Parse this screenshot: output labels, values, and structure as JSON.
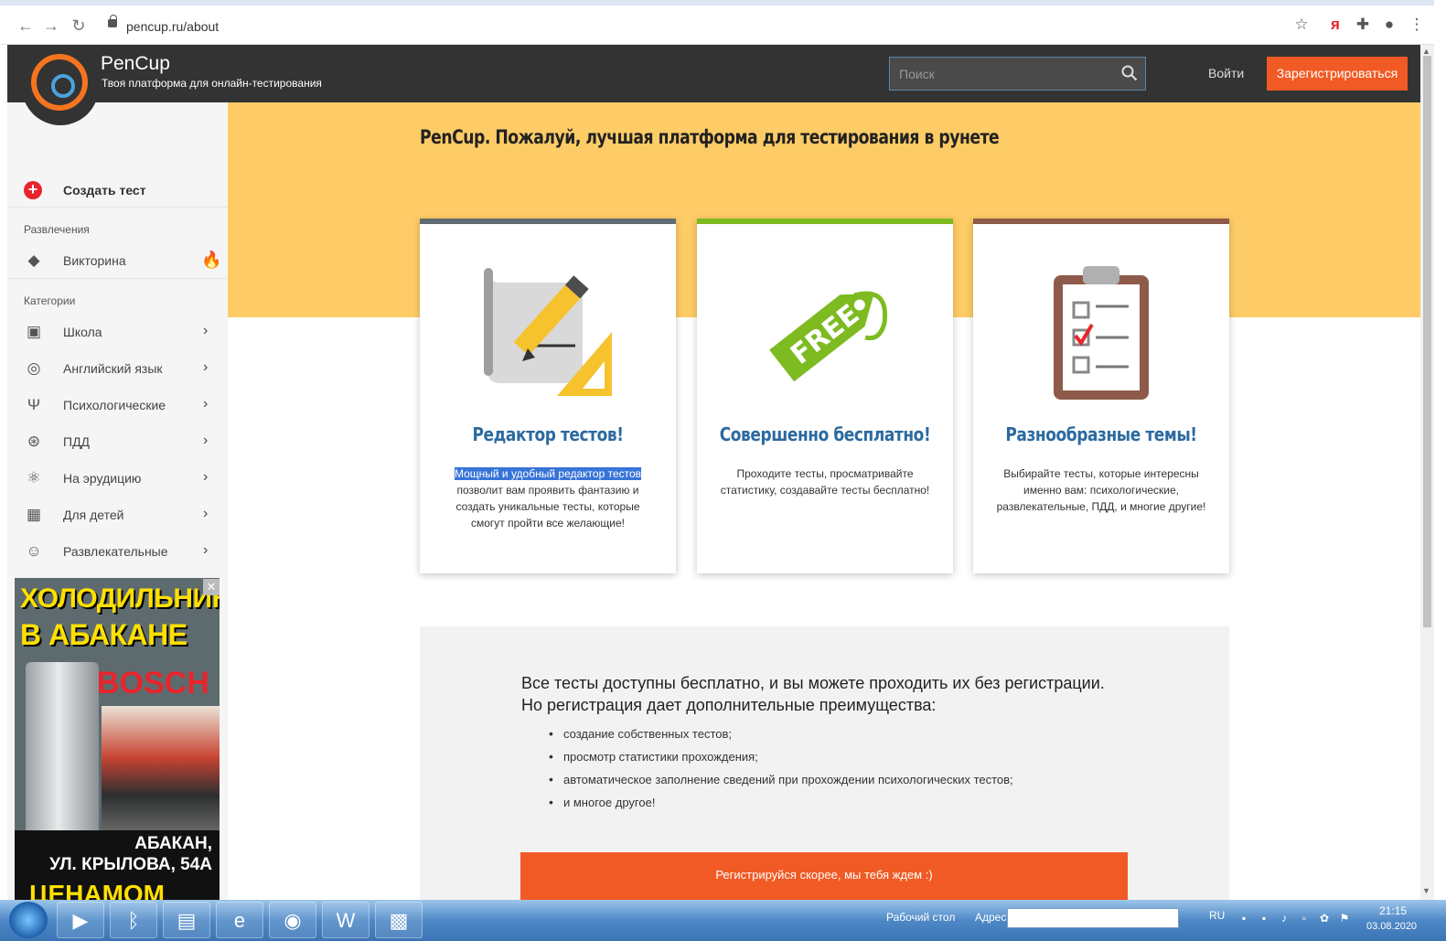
{
  "browser": {
    "url": "pencup.ru/about",
    "icons": [
      "back-icon",
      "forward-icon",
      "reload-icon",
      "lock-icon",
      "star-icon",
      "yandex-icon",
      "extensions-icon",
      "profile-icon",
      "menu-icon"
    ],
    "yandex_glyph": "я"
  },
  "header": {
    "brand": "PenCup",
    "tagline": "Твоя платформа для онлайн-тестирования",
    "search_placeholder": "Поиск",
    "login": "Войти",
    "register": "Зарегистрироваться"
  },
  "sidebar": {
    "create": "Создать тест",
    "section_fun": "Развлечения",
    "quiz": "Викторина",
    "section_categories": "Категории",
    "categories": [
      {
        "label": "Школа",
        "icon": "school-icon"
      },
      {
        "label": "Английский язык",
        "icon": "english-icon"
      },
      {
        "label": "Психологические",
        "icon": "psi-icon"
      },
      {
        "label": "ПДД",
        "icon": "steering-wheel-icon"
      },
      {
        "label": "На эрудицию",
        "icon": "atom-icon"
      },
      {
        "label": "Для детей",
        "icon": "blocks-icon"
      },
      {
        "label": "Развлекательные",
        "icon": "smiley-icon"
      }
    ]
  },
  "ad": {
    "line1": "ХОЛОДИЛЬНИКИ",
    "line2": "В АБАКАНЕ",
    "brand": "BOSCH",
    "city": "АБАКАН,",
    "street": "УЛ. КРЫЛОВА, 54А",
    "bottom": "ЦЕНАМОМ"
  },
  "main": {
    "title": "PenCup. Пожалуй, лучшая платформа для тестирования в рунете",
    "cards": [
      {
        "title": "Редактор тестов!",
        "highlight": "Мощный и удобный редактор тестов",
        "text": " позволит вам проявить фантазию и создать уникальные тесты, которые смогут пройти все желающие!",
        "accent": "#5f6b70"
      },
      {
        "title": "Совершенно бесплатно!",
        "highlight": "",
        "text": "Проходите тесты, просматривайте статистику, создавайте тесты бесплатно!",
        "accent": "#7dbb21"
      },
      {
        "title": "Разнообразные темы!",
        "highlight": "",
        "text": "Выбирайте тесты, которые интересны именно вам: психологические, развлекательные, ПДД, и многие другие!",
        "accent": "#8e5a4a"
      }
    ],
    "free_tag": "FREE",
    "info_line1": "Все тесты доступны бесплатно, и вы можете проходить их без регистрации.",
    "info_line2": "Но регистрация дает дополнительные преимущества:",
    "benefits": [
      "создание собственных тестов;",
      "просмотр статистики прохождения;",
      "автоматическое заполнение сведений при прохождении психологических тестов;",
      "и многое другое!"
    ],
    "cta": "Регистрируйся скорее, мы тебя ждем :)"
  },
  "taskbar": {
    "desktop": "Рабочий стол",
    "address": "Адрес",
    "lang": "RU",
    "time": "21:15",
    "date": "03.08.2020"
  },
  "colors": {
    "accent": "#f15a24",
    "header_bg": "#333333",
    "hero_bg": "#fecc66",
    "title_blue": "#2c6aa0"
  }
}
